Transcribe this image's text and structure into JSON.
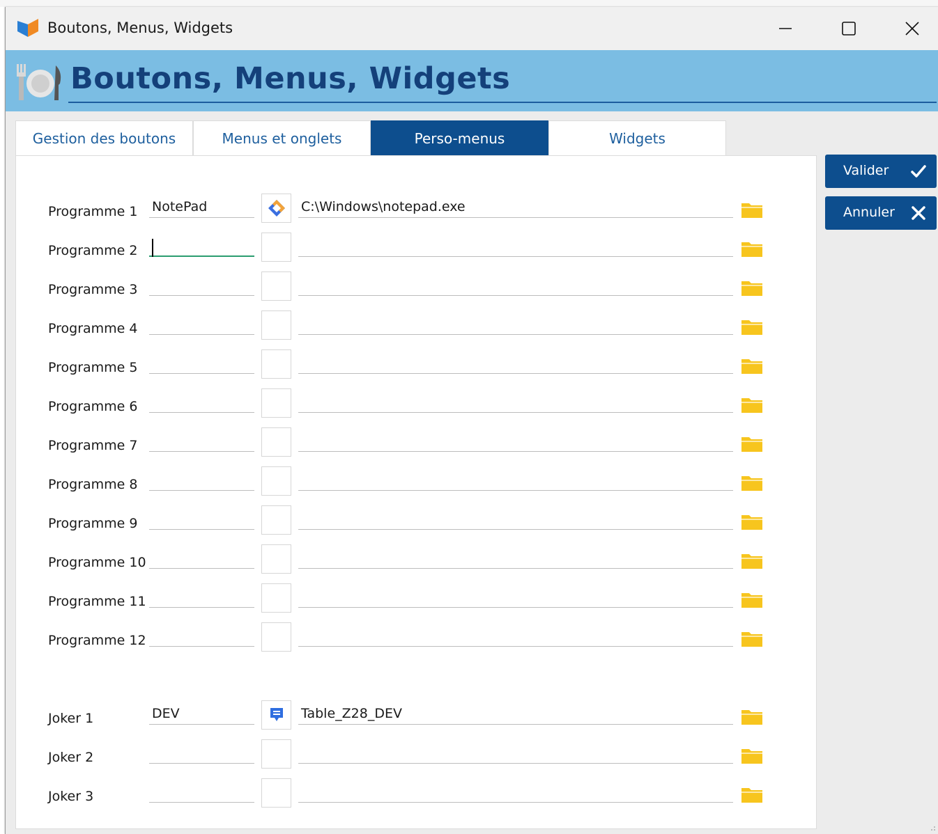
{
  "window": {
    "title": "Boutons, Menus, Widgets",
    "controls": [
      "minimize-icon",
      "maximize-icon",
      "close-icon"
    ]
  },
  "banner": {
    "title": "Boutons, Menus, Widgets",
    "icon": "cutlery-icon",
    "background": "#7bbde3",
    "title_color": "#14407a"
  },
  "tabs": [
    {
      "label": "Gestion des boutons",
      "active": false
    },
    {
      "label": "Menus et onglets",
      "active": false
    },
    {
      "label": "Perso-menus",
      "active": true
    },
    {
      "label": "Widgets",
      "active": false
    }
  ],
  "actions": {
    "validate_label": "Valider",
    "cancel_label": "Annuler",
    "accent": "#0d4e8e"
  },
  "programs": [
    {
      "label": "Programme 1",
      "name": "NotePad",
      "path": "C:\\Windows\\notepad.exe",
      "icon": "notepad-app-icon"
    },
    {
      "label": "Programme 2",
      "name": "",
      "path": "",
      "focused": true
    },
    {
      "label": "Programme 3",
      "name": "",
      "path": ""
    },
    {
      "label": "Programme 4",
      "name": "",
      "path": ""
    },
    {
      "label": "Programme 5",
      "name": "",
      "path": ""
    },
    {
      "label": "Programme 6",
      "name": "",
      "path": ""
    },
    {
      "label": "Programme 7",
      "name": "",
      "path": ""
    },
    {
      "label": "Programme 8",
      "name": "",
      "path": ""
    },
    {
      "label": "Programme 9",
      "name": "",
      "path": ""
    },
    {
      "label": "Programme 10",
      "name": "",
      "path": ""
    },
    {
      "label": "Programme 11",
      "name": "",
      "path": ""
    },
    {
      "label": "Programme 12",
      "name": "",
      "path": ""
    }
  ],
  "jokers": [
    {
      "label": "Joker 1",
      "name": "DEV",
      "path": "Table_Z28_DEV",
      "icon": "comment-icon"
    },
    {
      "label": "Joker 2",
      "name": "",
      "path": ""
    },
    {
      "label": "Joker 3",
      "name": "",
      "path": ""
    }
  ]
}
